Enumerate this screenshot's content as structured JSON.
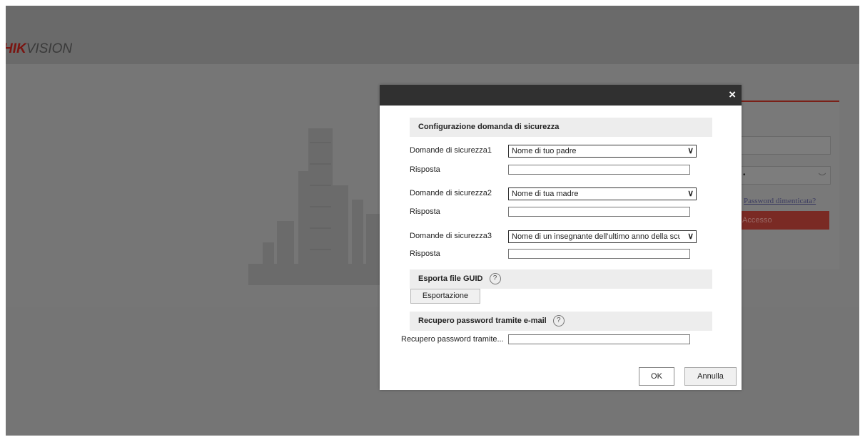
{
  "logo": {
    "hik": "HIK",
    "vision": "VISION"
  },
  "login": {
    "password_mask": "•",
    "forgot_link": "Password dimenticata?",
    "login_button": "Accesso"
  },
  "dialog": {
    "close": "×",
    "security_section_title": "Configurazione domanda di sicurezza",
    "questions": [
      {
        "label": "Domande di sicurezza1",
        "selected": "Nome di tuo padre",
        "answer_label": "Risposta",
        "answer": ""
      },
      {
        "label": "Domande di sicurezza2",
        "selected": "Nome di tua madre",
        "answer_label": "Risposta",
        "answer": ""
      },
      {
        "label": "Domande di sicurezza3",
        "selected": "Nome di un insegnante dell'ultimo anno della scuola",
        "answer_label": "Risposta",
        "answer": ""
      }
    ],
    "guid_section_title": "Esporta file GUID",
    "export_button": "Esportazione",
    "email_section_title": "Recupero password tramite e-mail",
    "email_label": "Recupero password tramite...",
    "email_value": "",
    "ok_button": "OK",
    "cancel_button": "Annulla",
    "help_glyph": "?",
    "caret_glyph": "∨"
  },
  "colors": {
    "overlay_bg": "#7a7a7a",
    "dialog_header": "#303030",
    "section_bg": "#ededed",
    "brand_red": "#7a2018"
  }
}
